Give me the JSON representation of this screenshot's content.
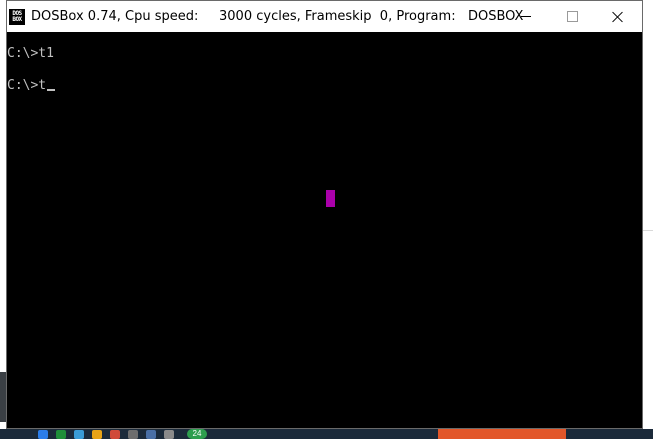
{
  "window": {
    "title": "DOSBox 0.74, Cpu speed:     3000 cycles, Frameskip  0, Program:   DOSBOX",
    "icon_text_top": "DOS",
    "icon_text_bottom": "BOX",
    "icon": "dosbox-app-icon",
    "controls": {
      "minimize_icon": "minimize-icon",
      "maximize_icon": "maximize-icon",
      "close_icon": "close-icon"
    }
  },
  "console": {
    "lines": [
      "C:\\>t1",
      "C:\\>t"
    ],
    "text_color": "#c0c0c0",
    "background_color": "#000000",
    "sprite_color": "#aa00aa"
  },
  "taskbar": {
    "badge": "24"
  }
}
